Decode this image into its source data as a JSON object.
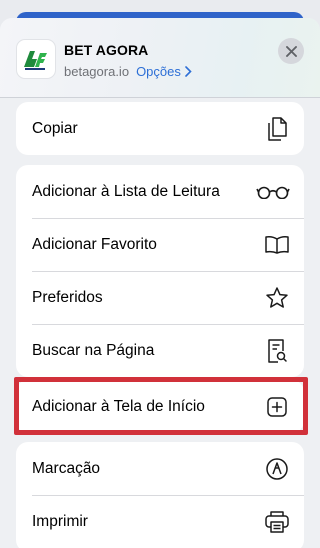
{
  "header": {
    "app_name": "BET AGORA",
    "domain": "betagora.io",
    "options_label": "Opções",
    "icons": {
      "app": "bet-agora-logo",
      "close": "close-icon",
      "options": "chevron-right-icon"
    }
  },
  "groups": [
    {
      "items": [
        {
          "label": "Copiar",
          "icon": "copy-icon"
        }
      ]
    },
    {
      "items": [
        {
          "label": "Adicionar à Lista de Leitura",
          "icon": "glasses-icon"
        },
        {
          "label": "Adicionar Favorito",
          "icon": "book-icon"
        },
        {
          "label": "Preferidos",
          "icon": "star-icon"
        },
        {
          "label": "Buscar na Página",
          "icon": "search-page-icon"
        }
      ]
    },
    {
      "items": [
        {
          "label": "Adicionar à Tela de Início",
          "icon": "add-square-icon"
        }
      ]
    },
    {
      "items": [
        {
          "label": "Marcação",
          "icon": "markup-icon"
        },
        {
          "label": "Imprimir",
          "icon": "printer-icon"
        }
      ]
    }
  ],
  "colors": {
    "accent": "#2d6fd6",
    "highlight": "#d1313a",
    "background": "#eef0f3"
  }
}
